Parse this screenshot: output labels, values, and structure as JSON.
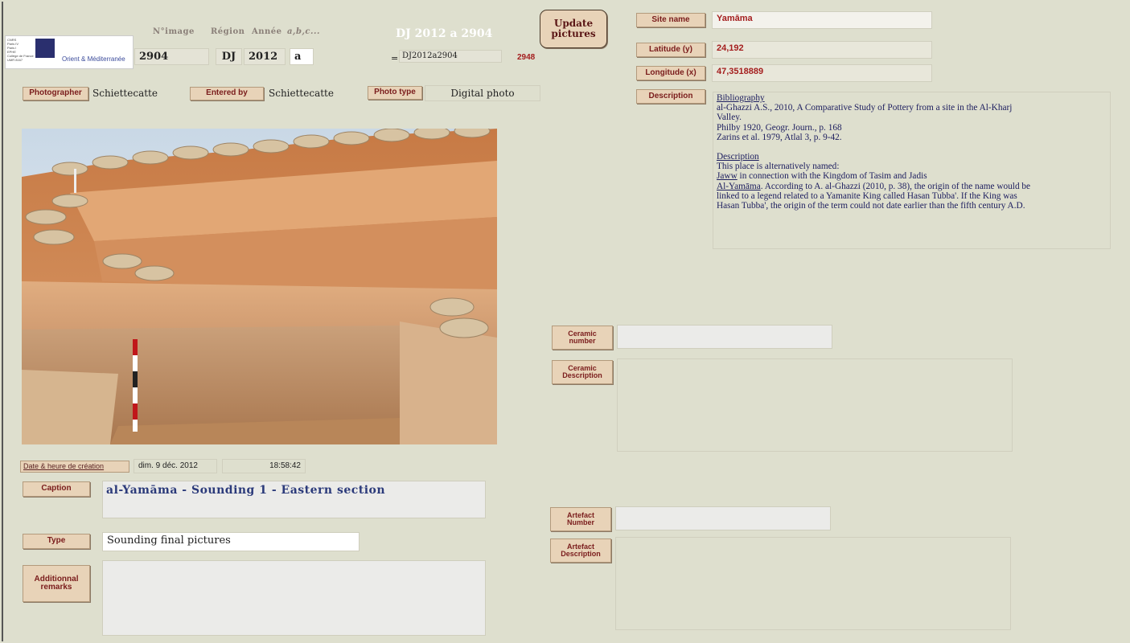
{
  "logo": {
    "label": "Orient & Méditerranée",
    "small_lines": [
      "CNRS",
      "Paris IV",
      "Paris I",
      "EPHE",
      "Collège de France",
      "UMR 8167"
    ]
  },
  "headers": {
    "nimage": "N°image",
    "region": "Région",
    "annee": "Année",
    "abc": "a,b,c..."
  },
  "record": {
    "nimage": "2904",
    "region": "DJ",
    "annee": "2012",
    "abc": "a",
    "code_title": "DJ 2012 a 2904",
    "code_eq": "=",
    "code_field": "DJ2012a2904",
    "count": "2948"
  },
  "update_button": "Update pictures",
  "photographer": {
    "label": "Photographer",
    "value": "Schiettecatte"
  },
  "entered_by": {
    "label": "Entered by",
    "value": "Schiettecatte"
  },
  "photo_type": {
    "label": "Photo type",
    "value": "Digital photo"
  },
  "site": {
    "name_label": "Site name",
    "name_value": "Yamāma",
    "lat_label": "Latitude (y)",
    "lat_value": "24,192",
    "lon_label": "Longitude (x)",
    "lon_value": "47,3518889",
    "desc_label": "Description",
    "desc_lines": [
      {
        "t": "Bibliography",
        "u": true
      },
      {
        "t": "al-Ghazzi A.S., 2010, A Comparative Study of Pottery from a site in the Al-Kharj",
        "u": false
      },
      {
        "t": "Valley.",
        "u": false
      },
      {
        "t": "Philby 1920, Geogr. Journ., p. 168",
        "u": false
      },
      {
        "t": "Zarins et al. 1979, Atlal 3, p. 9-42.",
        "u": false
      },
      {
        "t": " ",
        "u": false
      },
      {
        "t": "Description",
        "u": true
      },
      {
        "t": "This place is alternatively named:",
        "u": false
      }
    ],
    "jaww_word": "Jaww",
    "jaww_rest": " in connection with the Kingdom of Tasim and Jadis",
    "yamama_word": "Al-Yamāma",
    "yamama_rest": ". According to A. al-Ghazzi (2010, p. 38), the origin of the name would be",
    "tail_lines": [
      "linked to a legend related to a Yamanite King called Hasan Tubba'. If the King was",
      "Hasan Tubba', the origin of the term could not date earlier than the fifth century A.D."
    ]
  },
  "creation": {
    "label": "Date & heure de création",
    "date": "dim. 9 déc. 2012",
    "time": "18:58:42"
  },
  "caption": {
    "label": "Caption",
    "value": "al-Yamāma - Sounding 1 - Eastern section"
  },
  "type": {
    "label": "Type",
    "value": "Sounding final pictures"
  },
  "remarks": {
    "label": "Additionnal remarks",
    "value": ""
  },
  "ceramic": {
    "number_label": "Ceramic number",
    "number_value": "",
    "desc_label": "Ceramic Description",
    "desc_value": ""
  },
  "artefact": {
    "number_label": "Artefact Number",
    "number_value": "",
    "desc_label": "Artefact Description",
    "desc_value": ""
  },
  "colors": {
    "button_bg": "#e8d3b8",
    "button_text": "#7a1c1c",
    "background": "#dedfce"
  }
}
